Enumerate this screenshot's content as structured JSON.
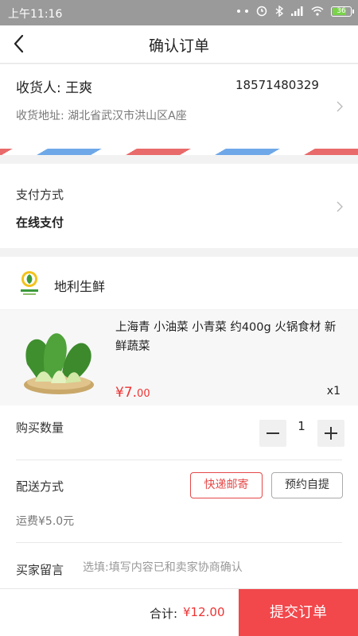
{
  "status_bar": {
    "time": "上午11:16",
    "battery": "36"
  },
  "nav": {
    "title": "确认订单"
  },
  "address": {
    "recipient": "收货人: 王爽",
    "phone": "18571480329",
    "address_line": "收货地址: 湖北省武汉市洪山区A座"
  },
  "payment": {
    "label": "支付方式",
    "value": "在线支付"
  },
  "shop": {
    "name": "地利生鲜"
  },
  "product": {
    "name": "上海青 小油菜 小青菜 约400g 火锅食材 新鲜蔬菜",
    "price_symbol": "¥7.",
    "price_decimals": "00",
    "quantity": "x1"
  },
  "purchase_quantity": {
    "label": "购买数量",
    "value": "1"
  },
  "delivery": {
    "label": "配送方式",
    "options": [
      "快递邮寄",
      "预约自提"
    ],
    "selected": "快递邮寄",
    "fee": "运费¥5.0元"
  },
  "buyer_note": {
    "label": "买家留言",
    "placeholder": "选填:填写内容已和卖家协商确认"
  },
  "footer": {
    "total_label": "合计:",
    "total_value": "¥12.00",
    "submit_label": "提交订单"
  },
  "colors": {
    "accent": "#f2474b",
    "price": "#e33333"
  }
}
